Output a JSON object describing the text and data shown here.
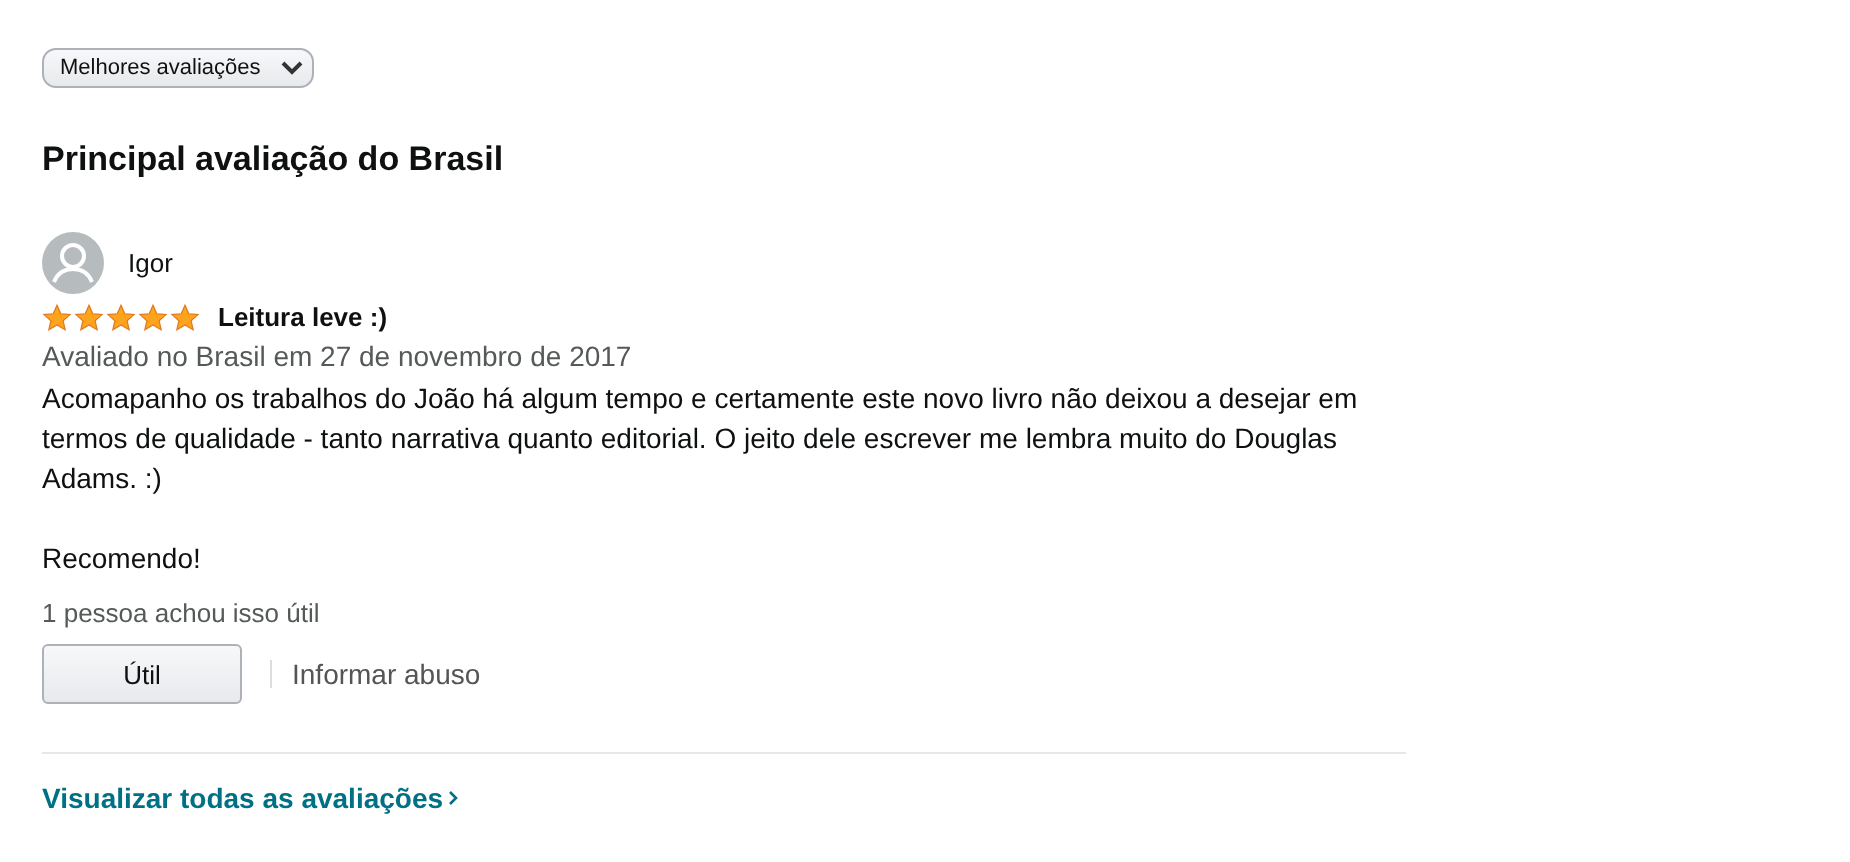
{
  "sort_dropdown": {
    "value": "Melhores avaliações"
  },
  "heading": "Principal avaliação do Brasil",
  "review": {
    "author": "Igor",
    "stars": 5,
    "title": "Leitura leve :)",
    "date": "Avaliado no Brasil em 27 de novembro de 2017",
    "paragraphs": [
      "Acomapanho os trabalhos do João há algum tempo e certamente este novo livro não deixou a desejar em termos de qualidade - tanto narrativa quanto editorial. O jeito dele escrever me lembra muito do Douglas Adams. :)",
      "Recomendo!"
    ],
    "helpful_count": "1 pessoa achou isso útil",
    "helpful_button": "Útil",
    "report_link": "Informar abuso"
  },
  "see_all_link": "Visualizar todas as avaliações"
}
